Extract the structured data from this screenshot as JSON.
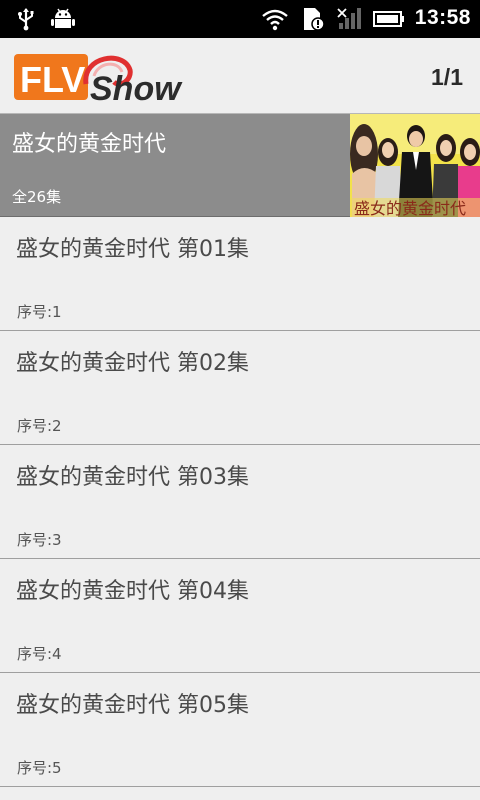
{
  "status_bar": {
    "time": "13:58",
    "icons": [
      "usb-icon",
      "android-debug-icon",
      "wifi-icon",
      "sim-alert-icon",
      "signal-off-icon",
      "battery-icon"
    ]
  },
  "header": {
    "logo_text": "FLV Show",
    "page_indicator": "1/1"
  },
  "featured": {
    "title": "盛女的黄金时代",
    "episode_count": "全26集",
    "poster_caption": "盛女的黄金时代"
  },
  "episodes": [
    {
      "title": "盛女的黄金时代 第01集",
      "index": "序号:1"
    },
    {
      "title": "盛女的黄金时代 第02集",
      "index": "序号:2"
    },
    {
      "title": "盛女的黄金时代 第03集",
      "index": "序号:3"
    },
    {
      "title": "盛女的黄金时代 第04集",
      "index": "序号:4"
    },
    {
      "title": "盛女的黄金时代 第05集",
      "index": "序号:5"
    }
  ],
  "colors": {
    "logo_orange": "#f0771c",
    "banner_gray": "#8c8c8c",
    "background": "#efefef"
  }
}
